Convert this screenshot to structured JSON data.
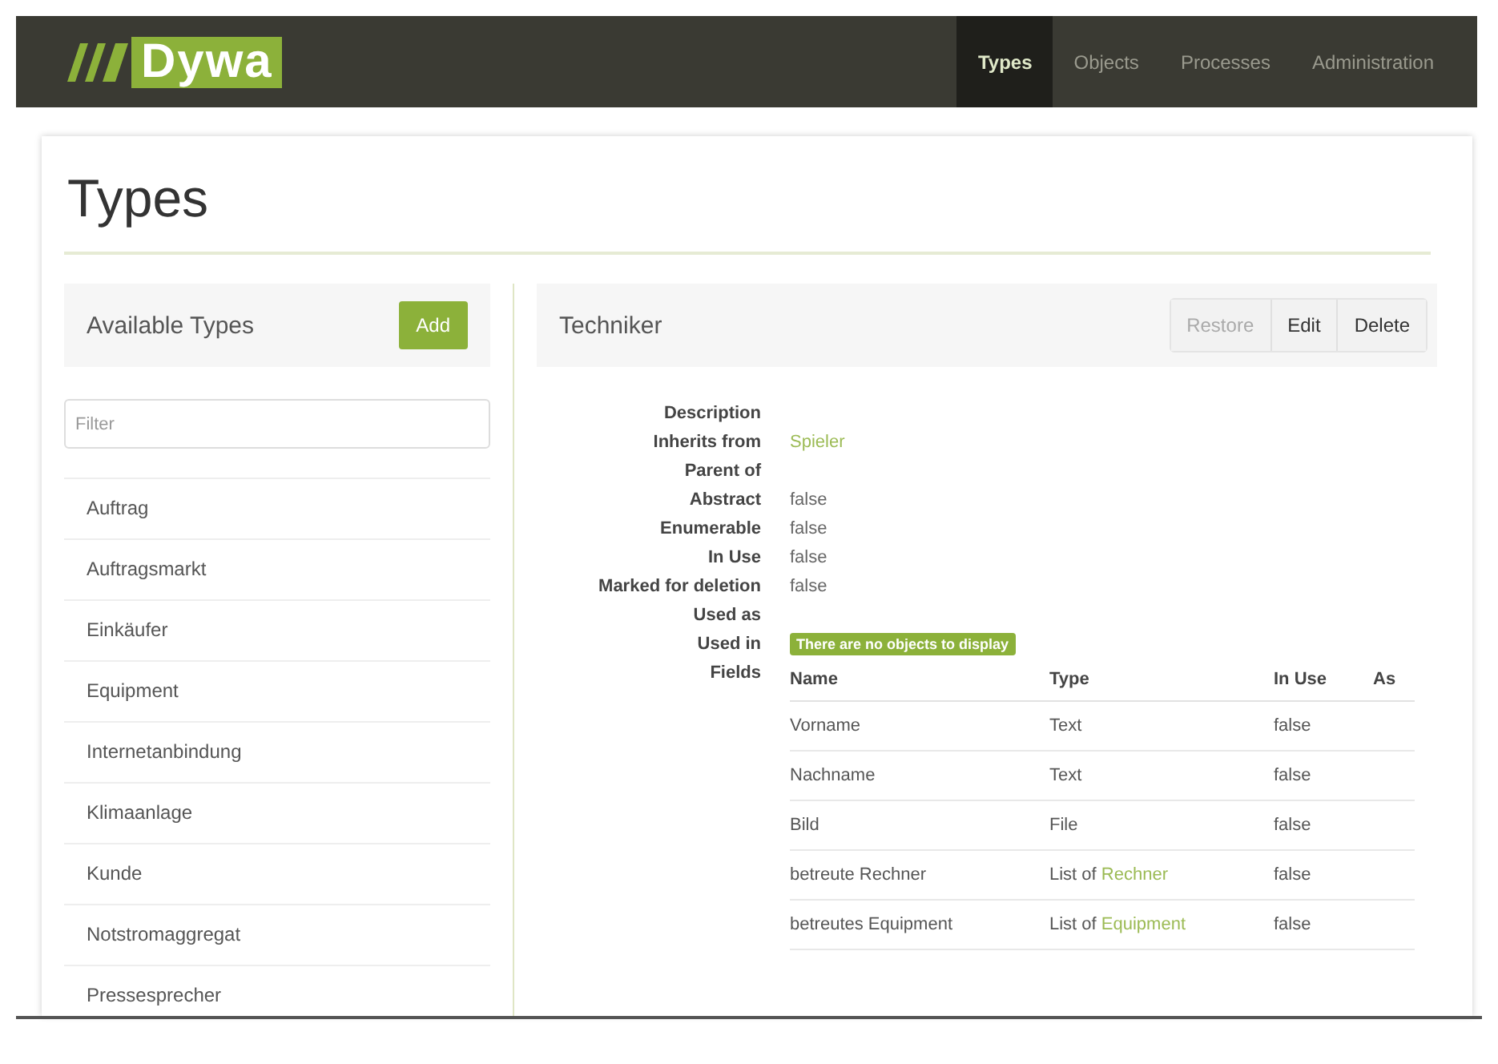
{
  "navbar": {
    "logo": "Dywa",
    "items": [
      {
        "label": "Types",
        "selected": true
      },
      {
        "label": "Objects",
        "selected": false
      },
      {
        "label": "Processes",
        "selected": false
      },
      {
        "label": "Administration",
        "selected": false
      }
    ]
  },
  "page_title": "Types",
  "sidebar": {
    "title": "Available Types",
    "add_button": "Add",
    "filter": {
      "placeholder": "Filter"
    },
    "items": [
      {
        "label": "Auftrag"
      },
      {
        "label": "Auftragsmarkt"
      },
      {
        "label": "Einkäufer"
      },
      {
        "label": "Equipment"
      },
      {
        "label": "Internetanbindung"
      },
      {
        "label": "Klimaanlage"
      },
      {
        "label": "Kunde"
      },
      {
        "label": "Notstromaggregat"
      },
      {
        "label": "Pressesprecher"
      }
    ]
  },
  "detail": {
    "title": "Techniker",
    "buttons": [
      {
        "label": "Restore",
        "disabled": true
      },
      {
        "label": "Edit",
        "disabled": false
      },
      {
        "label": "Delete",
        "disabled": false
      }
    ],
    "properties": [
      {
        "label": "Description"
      },
      {
        "label": "Inherits from",
        "link": "Spieler"
      },
      {
        "label": "Parent of"
      },
      {
        "label": "Abstract",
        "value": "false"
      },
      {
        "label": "Enumerable",
        "value": "false"
      },
      {
        "label": "In Use",
        "value": "false"
      },
      {
        "label": "Marked for deletion",
        "value": "false"
      },
      {
        "label": "Used as"
      },
      {
        "label": "Used in",
        "badge": "There are no objects to display"
      },
      {
        "label": "Fields",
        "kind": "table"
      }
    ],
    "fields": {
      "columns": [
        "Name",
        "Type",
        "In Use",
        "As"
      ],
      "rows": [
        {
          "name": "Vorname",
          "type": "Text",
          "in_use": "false"
        },
        {
          "name": "Nachname",
          "type": "Text",
          "in_use": "false"
        },
        {
          "name": "Bild",
          "type": "File",
          "in_use": "false"
        },
        {
          "name": "betreute Rechner",
          "type": "List of ",
          "type_link": "Rechner",
          "in_use": "false"
        },
        {
          "name": "betreutes Equipment",
          "type": "List of ",
          "type_link": "Equipment",
          "in_use": "false"
        }
      ]
    }
  }
}
